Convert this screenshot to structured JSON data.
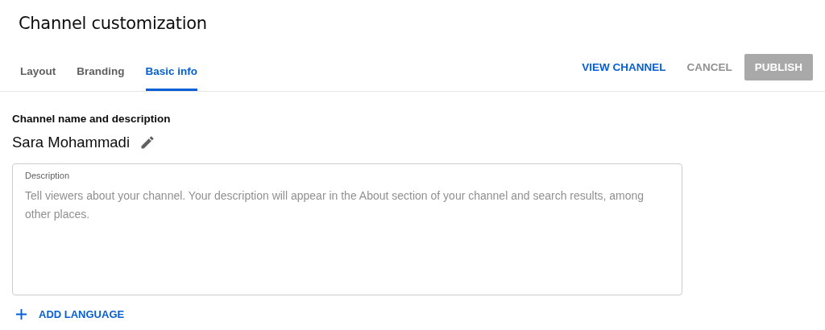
{
  "page": {
    "title": "Channel customization"
  },
  "tabs": [
    {
      "label": "Layout",
      "selected": false
    },
    {
      "label": "Branding",
      "selected": false
    },
    {
      "label": "Basic info",
      "selected": true
    }
  ],
  "actions": [
    {
      "label": "VIEW CHANNEL",
      "kind": "link",
      "disabled": false
    },
    {
      "label": "CANCEL",
      "kind": "text",
      "disabled": false
    },
    {
      "label": "PUBLISH",
      "kind": "filled",
      "disabled": true
    }
  ],
  "section": {
    "heading": "Channel name and description",
    "channel_name": "Sara Mohammadi"
  },
  "description": {
    "label": "Description",
    "placeholder": "Tell viewers about your channel. Your description will appear in the About section of your channel and search results, among other places."
  },
  "add_language": {
    "label": "ADD LANGUAGE"
  }
}
